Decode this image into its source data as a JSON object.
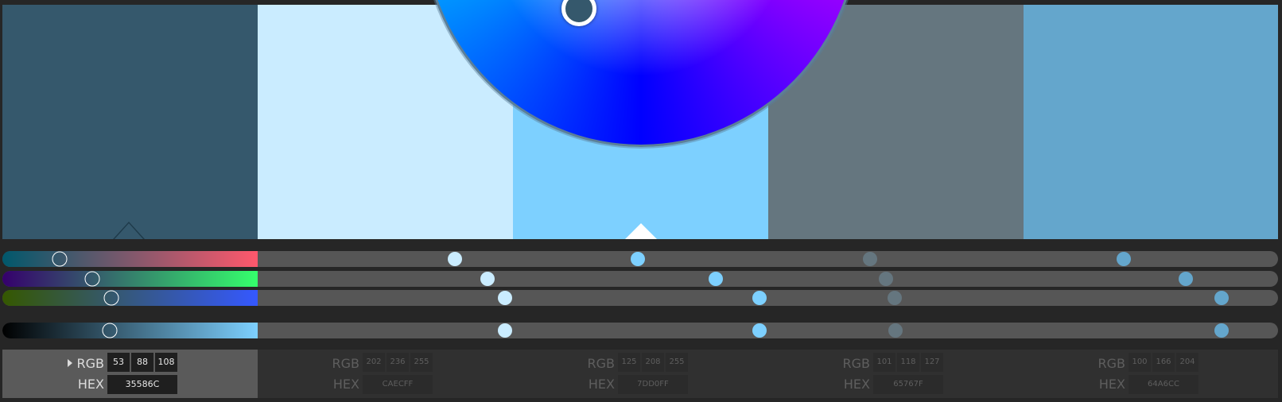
{
  "swatches": [
    {
      "hex": "#35586C",
      "rgb": [
        "53",
        "88",
        "108"
      ],
      "hex_label": "35586C",
      "active": true
    },
    {
      "hex": "#CAECFF",
      "rgb": [
        "202",
        "236",
        "255"
      ],
      "hex_label": "CAECFF",
      "active": false
    },
    {
      "hex": "#7DD0FF",
      "rgb": [
        "125",
        "208",
        "255"
      ],
      "hex_label": "7DD0FF",
      "active": false
    },
    {
      "hex": "#65767F",
      "rgb": [
        "101",
        "118",
        "127"
      ],
      "hex_label": "65767F",
      "active": false
    },
    {
      "hex": "#64A6CC",
      "rgb": [
        "100",
        "166",
        "204"
      ],
      "hex_label": "64A6CC",
      "active": false
    }
  ],
  "labels": {
    "rgb": "RGB",
    "hex": "HEX"
  },
  "colors": {
    "background": "#262626",
    "track": "#565656",
    "panel_active": "#5a5a5a",
    "panel": "#303030"
  },
  "slider_channels": [
    "r-channel",
    "g-channel",
    "b-channel",
    "brightness"
  ],
  "icons": [
    "caret-right-icon",
    "triangle-marker-icon",
    "color-wheel",
    "wheel-knob"
  ]
}
